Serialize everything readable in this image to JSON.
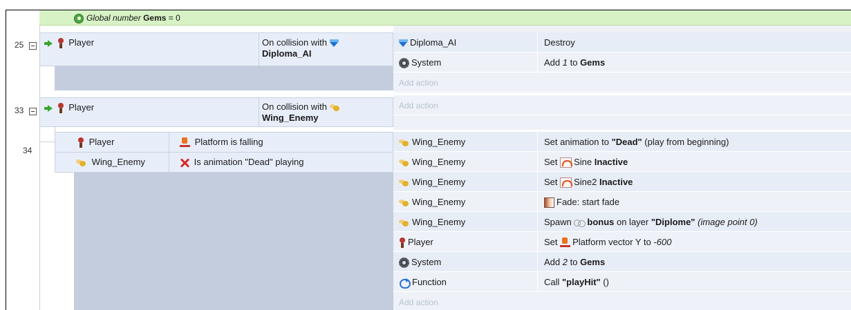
{
  "global_var": {
    "prefix": "Global number",
    "name": "Gems",
    "suffix": "= 0"
  },
  "events": [
    {
      "line": "25",
      "conditions": [
        {
          "object": "Player",
          "text": "On collision with",
          "target": "Diploma_AI"
        }
      ],
      "actions": [
        {
          "object": "Diploma_AI",
          "segments": [
            {
              "t": "Destroy"
            }
          ]
        },
        {
          "object": "System",
          "segments": [
            {
              "t": "Add "
            },
            {
              "t": "1",
              "i": true
            },
            {
              "t": " to "
            },
            {
              "t": "Gems",
              "b": true
            }
          ]
        }
      ],
      "add_action": "Add action"
    },
    {
      "line": "33",
      "conditions": [
        {
          "object": "Player",
          "text": "On collision with",
          "target": "Wing_Enemy"
        }
      ],
      "add_action": "Add action"
    },
    {
      "line": "34",
      "conditions": [
        {
          "object": "Player",
          "text": "Platform is falling"
        },
        {
          "object": "Wing_Enemy",
          "text": "Is animation \"Dead\" playing"
        }
      ],
      "actions": [
        {
          "object": "Wing_Enemy",
          "segments": [
            {
              "t": "Set animation to "
            },
            {
              "t": "\"Dead\"",
              "b": true
            },
            {
              "t": " (play from beginning)"
            }
          ]
        },
        {
          "object": "Wing_Enemy",
          "segments": [
            {
              "t": "Set "
            },
            {
              "t": "Sine "
            },
            {
              "t": "Inactive",
              "b": true
            }
          ]
        },
        {
          "object": "Wing_Enemy",
          "segments": [
            {
              "t": "Set "
            },
            {
              "t": "Sine2 "
            },
            {
              "t": "Inactive",
              "b": true
            }
          ]
        },
        {
          "object": "Wing_Enemy",
          "segments": [
            {
              "t": "Fade: start fade"
            }
          ]
        },
        {
          "object": "Wing_Enemy",
          "segments": [
            {
              "t": "Spawn "
            },
            {
              "t": "bonus",
              "b": true
            },
            {
              "t": " on layer "
            },
            {
              "t": "\"Diplome\"",
              "b": true
            },
            {
              "t": " "
            },
            {
              "t": "(image point 0)",
              "i": true
            }
          ]
        },
        {
          "object": "Player",
          "segments": [
            {
              "t": "Set "
            },
            {
              "t": "Platform vector Y to "
            },
            {
              "t": "-600",
              "i": true
            }
          ]
        },
        {
          "object": "System",
          "segments": [
            {
              "t": "Add "
            },
            {
              "t": "2",
              "i": true
            },
            {
              "t": " to "
            },
            {
              "t": "Gems",
              "b": true
            }
          ]
        },
        {
          "object": "Function",
          "segments": [
            {
              "t": "Call "
            },
            {
              "t": "\"playHit\"",
              "b": true
            },
            {
              "t": " ()"
            }
          ]
        }
      ],
      "add_action": "Add action"
    }
  ],
  "icons": {
    "global": "globe-icon",
    "trigger": "green-arrow-icon",
    "player": "player-sprite-icon",
    "diploma": "blue-gem-icon",
    "wing": "wing-enemy-icon",
    "system": "gear-icon",
    "function": "function-loop-icon",
    "platform": "platform-behavior-icon",
    "invert": "red-cross-icon",
    "sine": "sine-behavior-icon",
    "fade": "fade-behavior-icon",
    "bonus": "bonus-sprite-icon"
  },
  "colors": {
    "condition_bg": "#e8eef9",
    "action_bg": "#eef2f8",
    "variable_bg": "#d7f2c4",
    "add_action_text": "#b7c1d0"
  }
}
